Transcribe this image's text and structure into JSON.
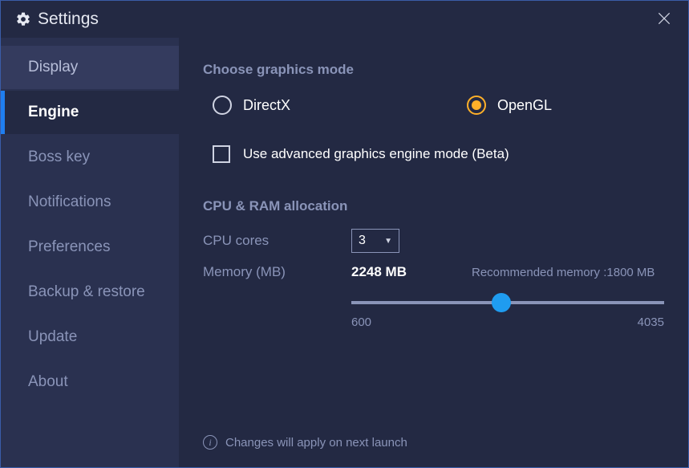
{
  "window": {
    "title": "Settings"
  },
  "sidebar": {
    "items": [
      {
        "label": "Display"
      },
      {
        "label": "Engine"
      },
      {
        "label": "Boss key"
      },
      {
        "label": "Notifications"
      },
      {
        "label": "Preferences"
      },
      {
        "label": "Backup & restore"
      },
      {
        "label": "Update"
      },
      {
        "label": "About"
      }
    ],
    "active_index": 1
  },
  "graphics": {
    "section_title": "Choose graphics mode",
    "options": {
      "directx": "DirectX",
      "opengl": "OpenGL"
    },
    "selected": "opengl",
    "advanced_checkbox_label": "Use advanced graphics engine mode (Beta)",
    "advanced_checked": false
  },
  "allocation": {
    "section_title": "CPU & RAM allocation",
    "cpu_label": "CPU cores",
    "cpu_value": "3",
    "memory_label": "Memory (MB)",
    "memory_value": "2248 MB",
    "memory_recommended": "Recommended memory :1800 MB",
    "slider_min": "600",
    "slider_max": "4035",
    "slider_percent": 48
  },
  "footer": {
    "note": "Changes will apply on next launch"
  },
  "colors": {
    "bg": "#232943",
    "sidebar": "#2a3150",
    "accent_blue": "#1f9cf0",
    "accent_orange": "#ffb029",
    "muted": "#8a94b8"
  }
}
